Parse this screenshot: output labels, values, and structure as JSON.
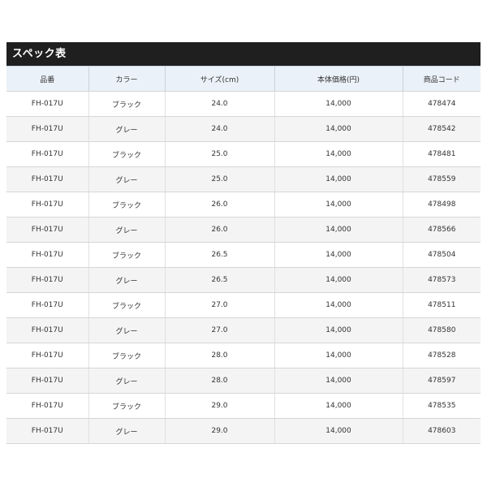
{
  "spec": {
    "title": "スペック表",
    "columns": [
      "品番",
      "カラー",
      "サイズ(cm)",
      "本体価格(円)",
      "商品コード"
    ],
    "rows": [
      [
        "FH-017U",
        "ブラック",
        "24.0",
        "14,000",
        "478474"
      ],
      [
        "FH-017U",
        "グレー",
        "24.0",
        "14,000",
        "478542"
      ],
      [
        "FH-017U",
        "ブラック",
        "25.0",
        "14,000",
        "478481"
      ],
      [
        "FH-017U",
        "グレー",
        "25.0",
        "14,000",
        "478559"
      ],
      [
        "FH-017U",
        "ブラック",
        "26.0",
        "14,000",
        "478498"
      ],
      [
        "FH-017U",
        "グレー",
        "26.0",
        "14,000",
        "478566"
      ],
      [
        "FH-017U",
        "ブラック",
        "26.5",
        "14,000",
        "478504"
      ],
      [
        "FH-017U",
        "グレー",
        "26.5",
        "14,000",
        "478573"
      ],
      [
        "FH-017U",
        "ブラック",
        "27.0",
        "14,000",
        "478511"
      ],
      [
        "FH-017U",
        "グレー",
        "27.0",
        "14,000",
        "478580"
      ],
      [
        "FH-017U",
        "ブラック",
        "28.0",
        "14,000",
        "478528"
      ],
      [
        "FH-017U",
        "グレー",
        "28.0",
        "14,000",
        "478597"
      ],
      [
        "FH-017U",
        "ブラック",
        "29.0",
        "14,000",
        "478535"
      ],
      [
        "FH-017U",
        "グレー",
        "29.0",
        "14,000",
        "478603"
      ]
    ]
  },
  "colors": {
    "title_bg": "#1f1f1f",
    "header_bg": "#eaf1f8",
    "row_alt_bg": "#f4f4f4"
  }
}
